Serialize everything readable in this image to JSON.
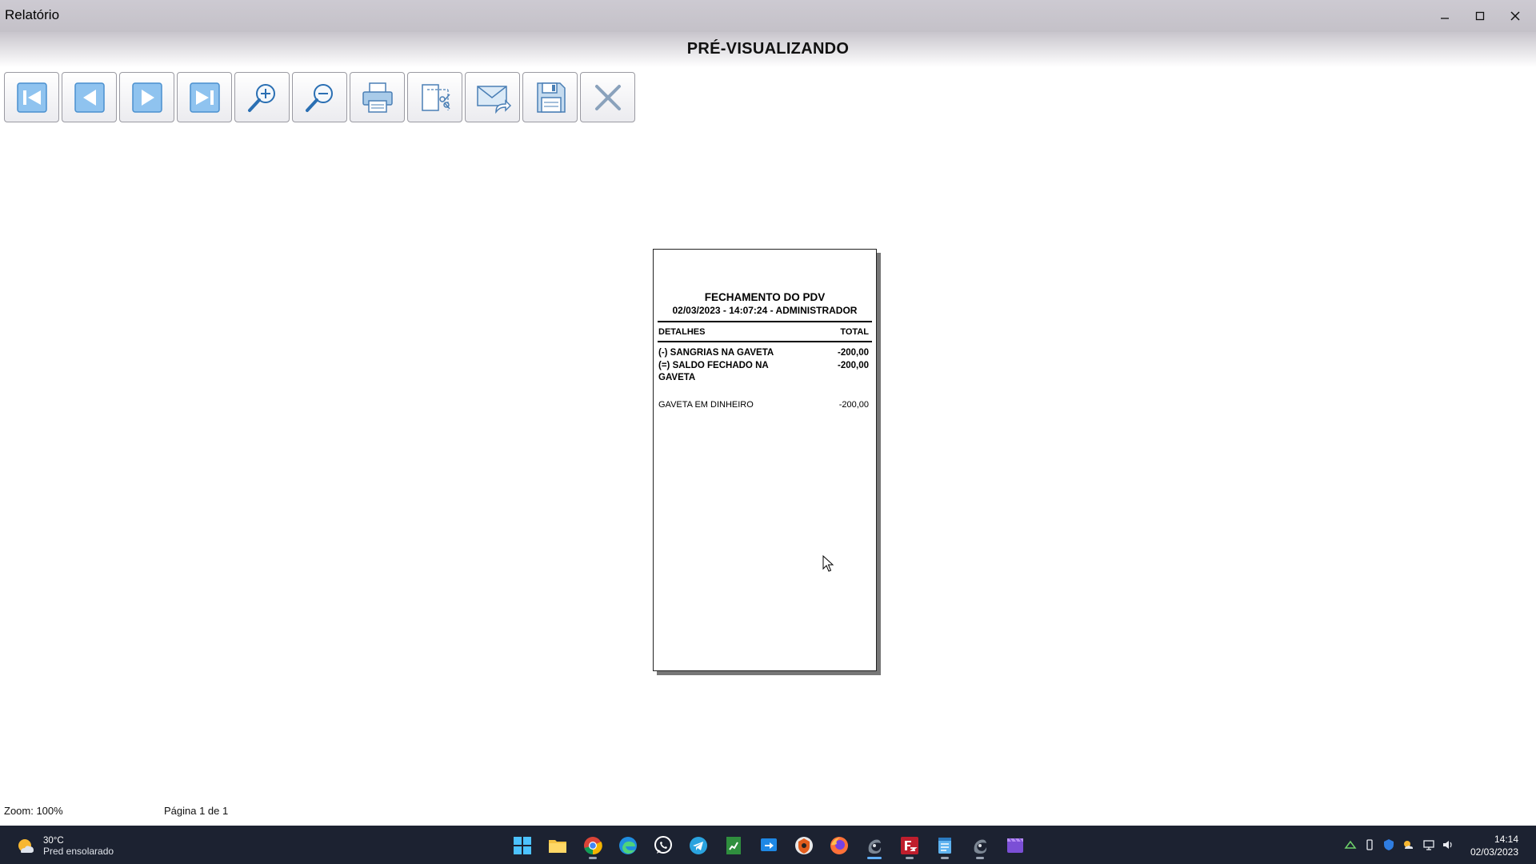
{
  "window": {
    "title": "Relatório",
    "controls": [
      "minimize-icon",
      "maximize-icon",
      "close-icon"
    ]
  },
  "header": {
    "heading": "PRÉ-VISUALIZANDO"
  },
  "toolbar": {
    "buttons": [
      {
        "name": "first-page",
        "icon": "first-page-icon"
      },
      {
        "name": "previous-page",
        "icon": "previous-page-icon"
      },
      {
        "name": "next-page",
        "icon": "next-page-icon"
      },
      {
        "name": "last-page",
        "icon": "last-page-icon"
      },
      {
        "name": "zoom-in",
        "icon": "zoom-in-icon"
      },
      {
        "name": "zoom-out",
        "icon": "zoom-out-icon"
      },
      {
        "name": "print",
        "icon": "printer-icon"
      },
      {
        "name": "page-setup",
        "icon": "page-setup-icon"
      },
      {
        "name": "send-email",
        "icon": "email-send-icon"
      },
      {
        "name": "save",
        "icon": "floppy-disk-icon"
      },
      {
        "name": "close-preview",
        "icon": "close-x-icon"
      }
    ]
  },
  "report": {
    "title": "FECHAMENTO DO PDV",
    "subtitle": "02/03/2023 - 14:07:24 - ADMINISTRADOR",
    "col_details": "DETALHES",
    "col_total": "TOTAL",
    "rows": [
      {
        "label": "(-) SANGRIAS NA GAVETA",
        "value": "-200,00"
      },
      {
        "label": "(=) SALDO FECHADO NA GAVETA",
        "value": "-200,00"
      }
    ],
    "summary": {
      "label": "GAVETA EM DINHEIRO",
      "value": "-200,00"
    }
  },
  "status": {
    "zoom": "Zoom: 100%",
    "page": "Página 1 de 1"
  },
  "taskbar": {
    "weather": {
      "temp": "30°C",
      "condition": "Pred ensolarado"
    },
    "clock": {
      "time": "14:14",
      "date": "02/03/2023"
    }
  }
}
